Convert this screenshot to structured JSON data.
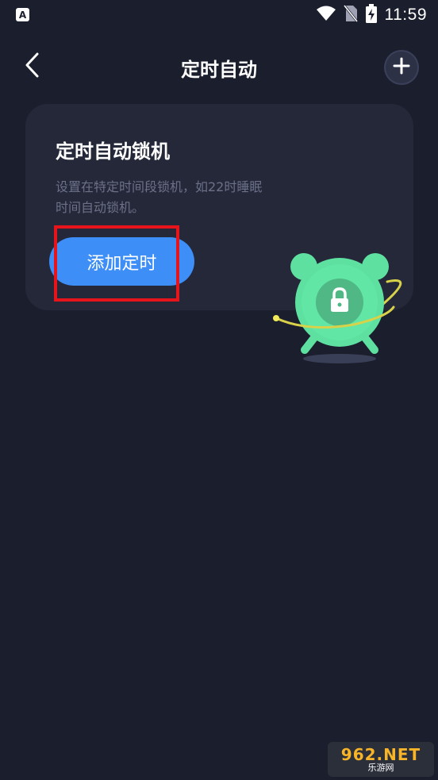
{
  "status_bar": {
    "time": "11:59",
    "app_icon_letter": "A",
    "icons": [
      "wifi-icon",
      "no-sim-icon",
      "battery-charging-icon"
    ]
  },
  "header": {
    "title": "定时自动",
    "back_icon": "chevron-left-icon",
    "add_icon": "plus-icon"
  },
  "card": {
    "title": "定时自动锁机",
    "description": "设置在特定时间段锁机，如22时睡眠时间自动锁机。",
    "button_label": "添加定时",
    "illustration": "alarm-clock-lock-icon"
  },
  "watermark": {
    "main": "962.NET",
    "sub": "乐游网"
  },
  "colors": {
    "background": "#1b1e2c",
    "card": "#242839",
    "accent": "#3d8ef6",
    "clock_green": "#5ee0a0",
    "highlight_red": "#e8141c"
  }
}
